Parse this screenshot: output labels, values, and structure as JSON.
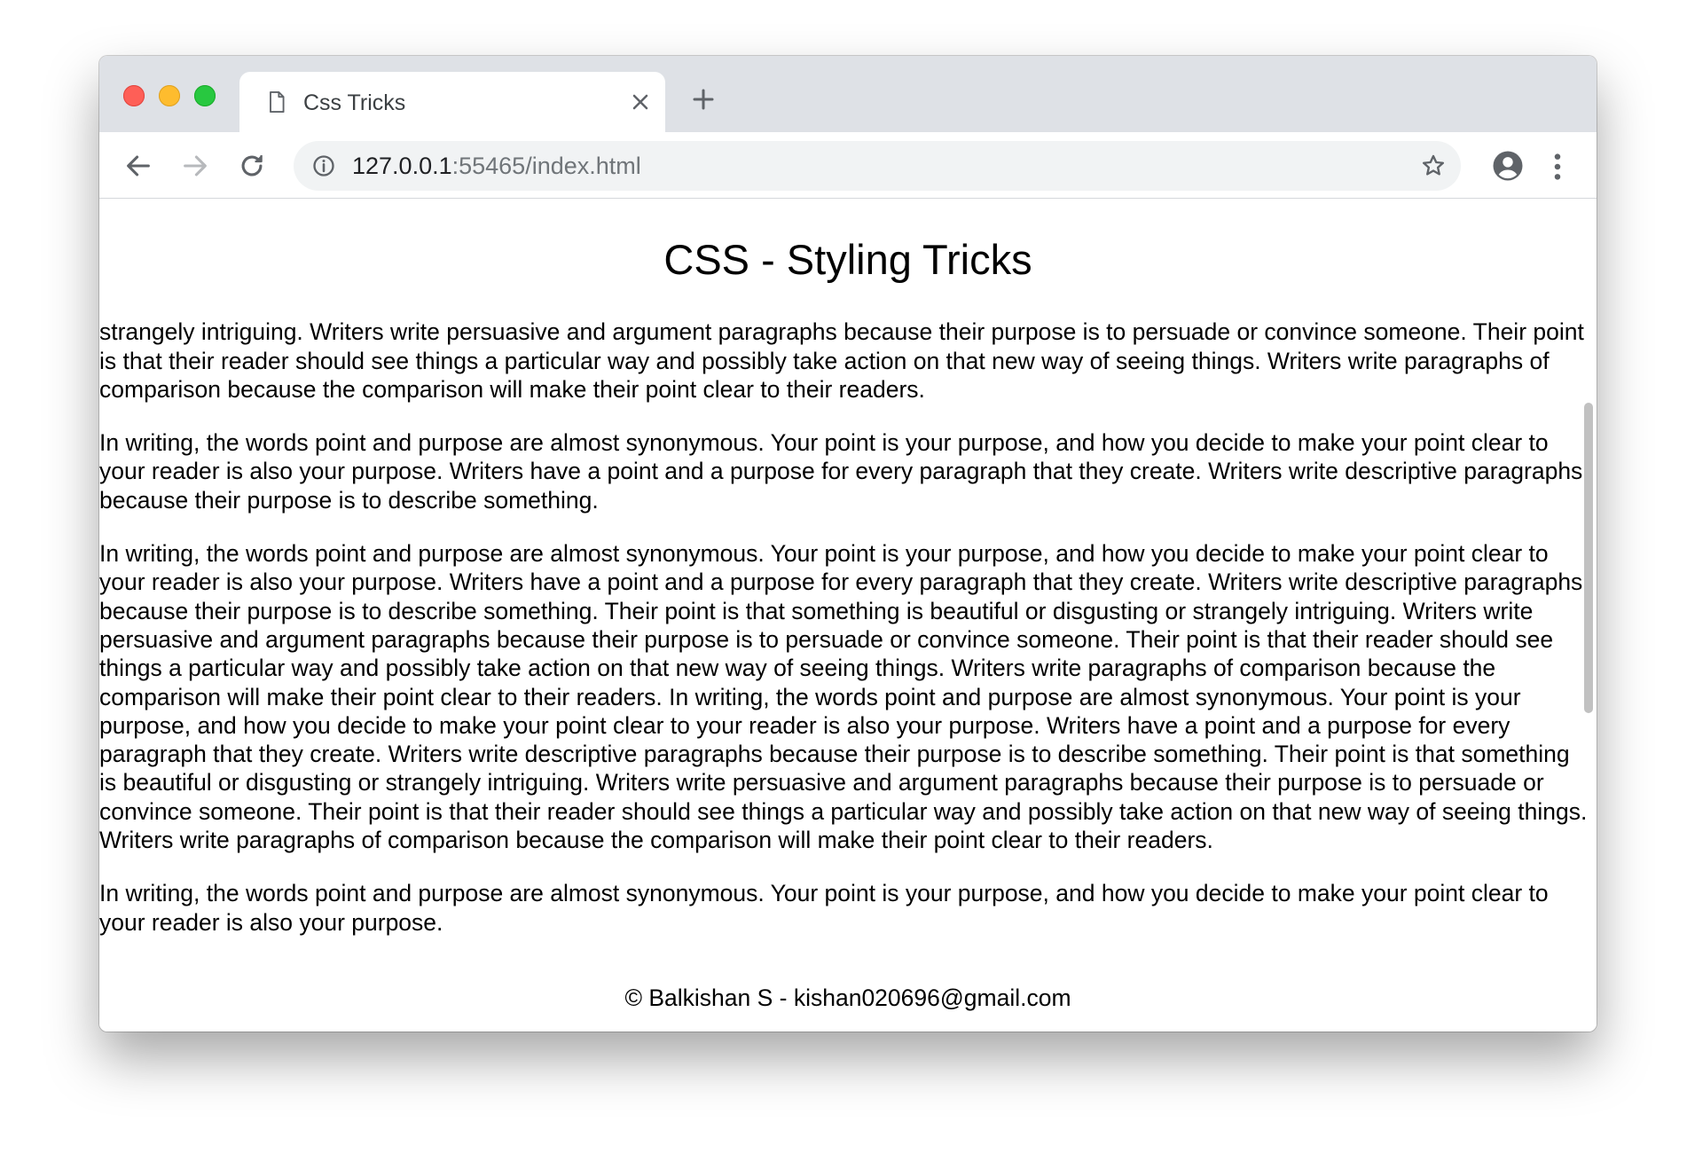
{
  "browser": {
    "tab": {
      "title": "Css Tricks",
      "page_icon": "document-icon",
      "close_icon": "close-icon"
    },
    "new_tab_icon": "plus-icon",
    "toolbar": {
      "back_icon": "arrow-left-icon",
      "forward_icon": "arrow-right-icon",
      "reload_icon": "reload-icon",
      "info_icon": "info-icon",
      "url_host": "127.0.0.1",
      "url_rest": ":55465/index.html",
      "bookmark_icon": "star-icon",
      "profile_icon": "account-circle-icon",
      "menu_icon": "more-vertical-icon"
    },
    "colors": {
      "close": "#fe5f57",
      "minimize": "#febc2e",
      "maximize": "#28c840",
      "tabstrip": "#dee1e6",
      "omnibox": "#f1f3f4"
    }
  },
  "page": {
    "title": "CSS - Styling Tricks",
    "paragraphs": [
      "Writers write descriptive paragraphs because their purpose is to describe something. Their point is that something is beautiful or disgusting or strangely intriguing. Writers write persuasive and argument paragraphs because their purpose is to persuade or convince someone. Their point is that their reader should see things a particular way and possibly take action on that new way of seeing things. Writers write paragraphs of comparison because the comparison will make their point clear to their readers.",
      "In writing, the words point and purpose are almost synonymous. Your point is your purpose, and how you decide to make your point clear to your reader is also your purpose. Writers have a point and a purpose for every paragraph that they create. Writers write descriptive paragraphs because their purpose is to describe something.",
      "In writing, the words point and purpose are almost synonymous. Your point is your purpose, and how you decide to make your point clear to your reader is also your purpose. Writers have a point and a purpose for every paragraph that they create. Writers write descriptive paragraphs because their purpose is to describe something. Their point is that something is beautiful or disgusting or strangely intriguing. Writers write persuasive and argument paragraphs because their purpose is to persuade or convince someone. Their point is that their reader should see things a particular way and possibly take action on that new way of seeing things. Writers write paragraphs of comparison because the comparison will make their point clear to their readers. In writing, the words point and purpose are almost synonymous. Your point is your purpose, and how you decide to make your point clear to your reader is also your purpose. Writers have a point and a purpose for every paragraph that they create. Writers write descriptive paragraphs because their purpose is to describe something. Their point is that something is beautiful or disgusting or strangely intriguing. Writers write persuasive and argument paragraphs because their purpose is to persuade or convince someone. Their point is that their reader should see things a particular way and possibly take action on that new way of seeing things. Writers write paragraphs of comparison because the comparison will make their point clear to their readers.",
      "In writing, the words point and purpose are almost synonymous. Your point is your purpose, and how you decide to make your point clear to your reader is also your purpose."
    ],
    "footer": "© Balkishan S - kishan020696@gmail.com"
  }
}
